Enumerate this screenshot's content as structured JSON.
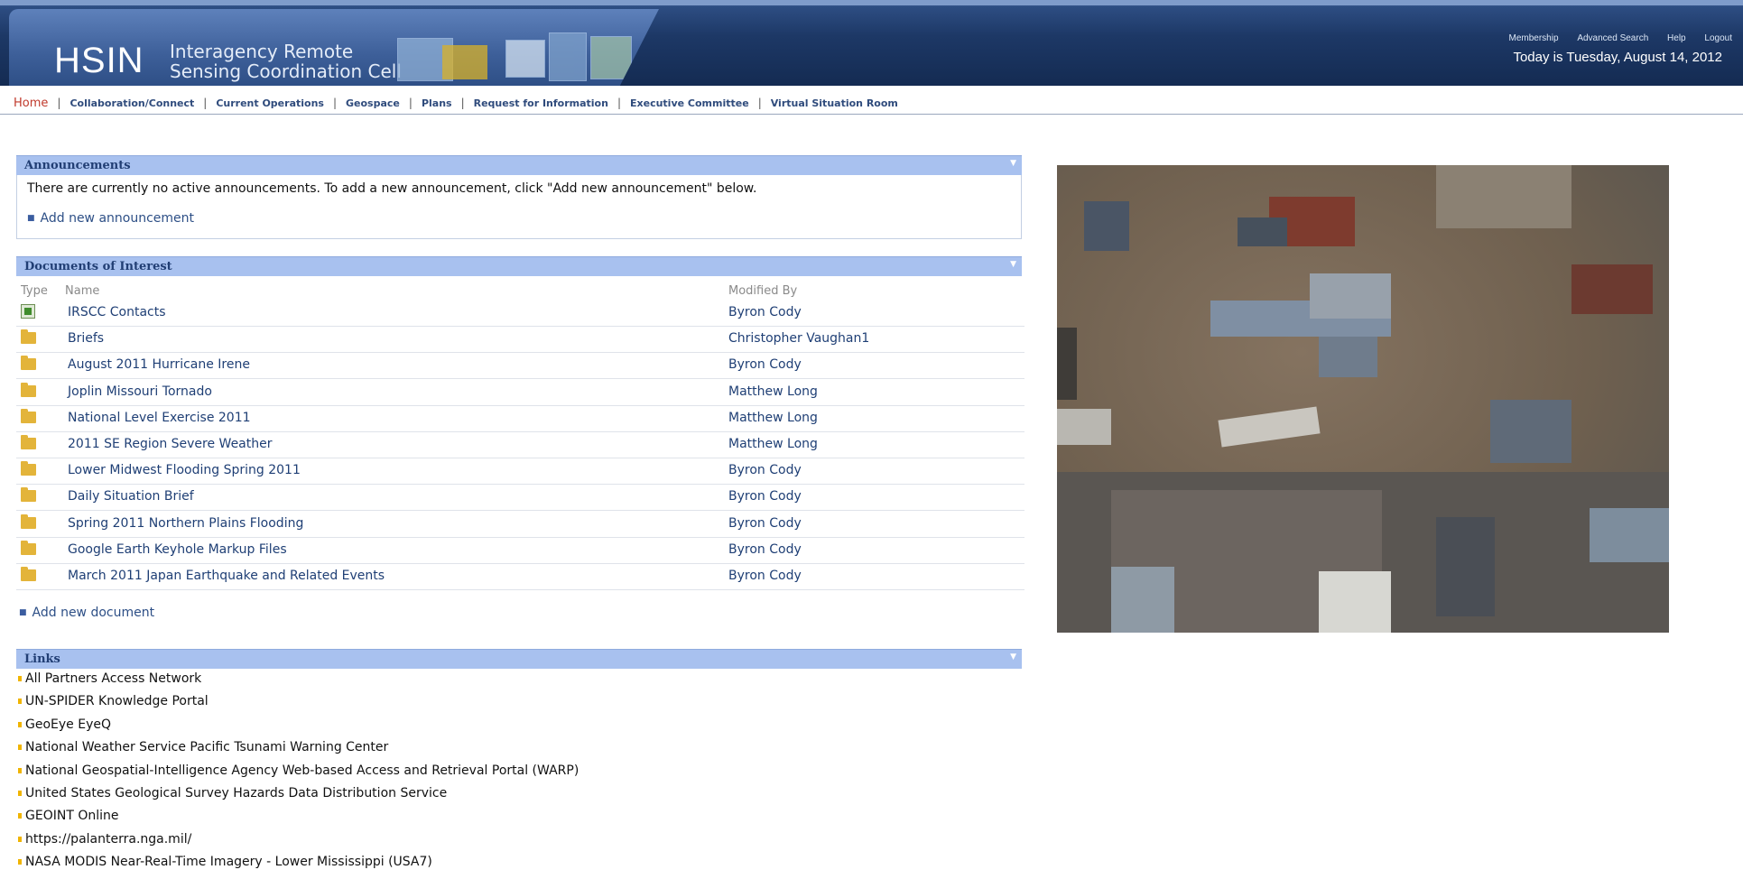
{
  "header": {
    "logo_text": "HSIN",
    "agency_line1": "Interagency Remote",
    "agency_line2": "Sensing Coordination Cell",
    "top_links": [
      "Membership",
      "Advanced Search",
      "Help",
      "Logout"
    ],
    "date_text": "Today is Tuesday, August 14, 2012"
  },
  "nav": {
    "items": [
      "Home",
      "Collaboration/Connect",
      "Current Operations",
      "Geospace",
      "Plans",
      "Request for Information",
      "Executive Committee",
      "Virtual Situation Room"
    ]
  },
  "announcements": {
    "title": "Announcements",
    "message": "There are currently no active announcements. To add a new announcement, click \"Add new announcement\" below.",
    "add_label": "Add new announcement"
  },
  "documents": {
    "title": "Documents of Interest",
    "col_type": "Type",
    "col_name": "Name",
    "col_modified": "Modified By",
    "rows": [
      {
        "name": "IRSCC Contacts",
        "modified_by": "Byron Cody",
        "icon": "spreadsheet-icon"
      },
      {
        "name": "Briefs",
        "modified_by": "Christopher Vaughan1",
        "icon": "folder-icon"
      },
      {
        "name": "August 2011 Hurricane Irene",
        "modified_by": "Byron Cody",
        "icon": "folder-icon"
      },
      {
        "name": "Joplin Missouri Tornado",
        "modified_by": "Matthew Long",
        "icon": "folder-icon"
      },
      {
        "name": "National Level Exercise 2011",
        "modified_by": "Matthew Long",
        "icon": "folder-icon"
      },
      {
        "name": "2011 SE Region Severe Weather",
        "modified_by": "Matthew Long",
        "icon": "folder-icon"
      },
      {
        "name": "Lower Midwest Flooding Spring 2011",
        "modified_by": "Byron Cody",
        "icon": "folder-icon"
      },
      {
        "name": "Daily Situation Brief",
        "modified_by": "Byron Cody",
        "icon": "folder-icon"
      },
      {
        "name": "Spring 2011 Northern Plains Flooding",
        "modified_by": "Byron Cody",
        "icon": "folder-icon"
      },
      {
        "name": "Google Earth Keyhole Markup Files",
        "modified_by": "Byron Cody",
        "icon": "folder-icon"
      },
      {
        "name": "March 2011 Japan Earthquake and Related Events",
        "modified_by": "Byron Cody",
        "icon": "folder-icon"
      }
    ],
    "add_label": "Add new document"
  },
  "links": {
    "title": "Links",
    "items": [
      "All Partners Access Network",
      "UN-SPIDER Knowledge Portal",
      "GeoEye EyeQ",
      "National Weather Service Pacific Tsunami Warning Center",
      "National Geospatial-Intelligence Agency Web-based Access and Retrieval Portal (WARP)",
      "United States Geological Survey Hazards Data Distribution Service",
      "GEOINT Online",
      "https://palanterra.nga.mil/",
      "NASA MODIS Near-Real-Time Imagery - Lower Mississippi (USA7)"
    ]
  }
}
